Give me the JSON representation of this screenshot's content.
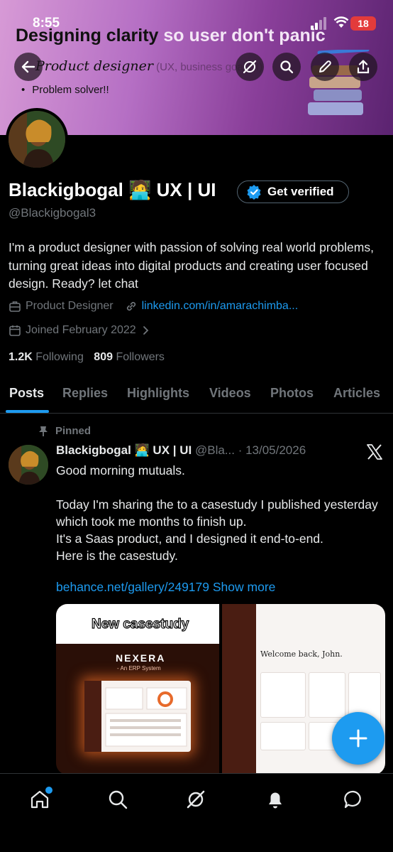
{
  "status_bar": {
    "time": "8:55",
    "battery": "18"
  },
  "banner": {
    "title_dark": "Designing clarity",
    "title_light": " so user don't panic",
    "subtitle": "Product designer",
    "subtitle_note": " (UX, business goal UI)",
    "bullet": "Problem solver!!"
  },
  "profile": {
    "name": "Blackigbogal 🧑‍💻 UX | UI",
    "get_verified_label": "Get verified",
    "handle": "@Blackigbogal3",
    "bio": "I'm a product designer with passion of solving real world problems, turning great ideas into digital products and creating user focused design. Ready? let chat",
    "profession": "Product Designer",
    "website": "linkedin.com/in/amarachimba...",
    "joined": "Joined February 2022",
    "following_count": "1.2K",
    "following_label": "Following",
    "followers_count": "809",
    "followers_label": "Followers"
  },
  "tabs": [
    "Posts",
    "Replies",
    "Highlights",
    "Videos",
    "Photos",
    "Articles"
  ],
  "pinned_post": {
    "pinned_label": "Pinned",
    "author": "Blackigbogal 🧑‍💻 UX | UI",
    "handle_date": "@Bla... · 13/05/2026",
    "text": "Good morning mutuals.\n\nToday I'm sharing the to a casestudy I published yesterday which took me months to finish up.\nIt's a Saas product, and I designed it end-to-end.\nHere is the casestudy.",
    "link": "behance.net/gallery/249179",
    "show_more": " Show more",
    "media_left_caption": "New casestudy",
    "media_left_brand": "NEXERA",
    "media_left_brand_sub": "- An ERP System",
    "media_right_heading": "Welcome back, John."
  },
  "icons": {
    "back": "back-arrow-icon",
    "grok": "grok-icon",
    "search": "search-icon",
    "edit": "edit-icon",
    "share": "share-icon",
    "verified": "verified-badge-icon",
    "profession": "briefcase-icon",
    "link": "link-icon",
    "calendar": "calendar-icon",
    "pin": "pin-icon",
    "x": "x-logo-icon",
    "compose": "plus-icon",
    "nav": [
      "home-icon",
      "search-icon",
      "grok-icon",
      "notifications-icon",
      "messages-icon"
    ]
  },
  "colors": {
    "accent": "#1d9bf0",
    "background": "#000000",
    "muted": "#71767b",
    "banner_start": "#d79ad6",
    "banner_end": "#5b2370"
  }
}
